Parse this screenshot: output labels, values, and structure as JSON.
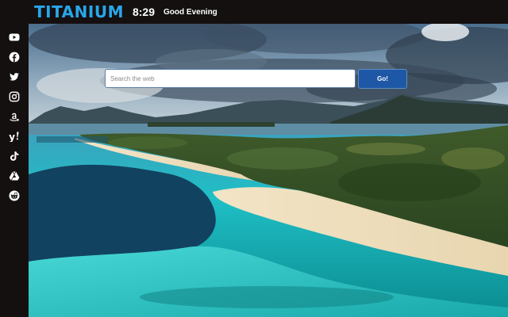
{
  "header": {
    "brand": "TITANIUM",
    "time": "8:29",
    "greeting": "Good Evening"
  },
  "sidebar": {
    "items": [
      {
        "icon": "youtube-icon"
      },
      {
        "icon": "facebook-icon"
      },
      {
        "icon": "twitter-icon"
      },
      {
        "icon": "instagram-icon"
      },
      {
        "icon": "amazon-icon"
      },
      {
        "icon": "yahoo-icon"
      },
      {
        "icon": "tiktok-icon"
      },
      {
        "icon": "google-drive-icon"
      },
      {
        "icon": "reddit-icon"
      }
    ]
  },
  "search": {
    "placeholder": "Search the web",
    "value": "",
    "button_label": "Go!"
  },
  "colors": {
    "brand": "#29a6e8",
    "bar_background": "#141010",
    "go_button": "#1e57a6"
  }
}
